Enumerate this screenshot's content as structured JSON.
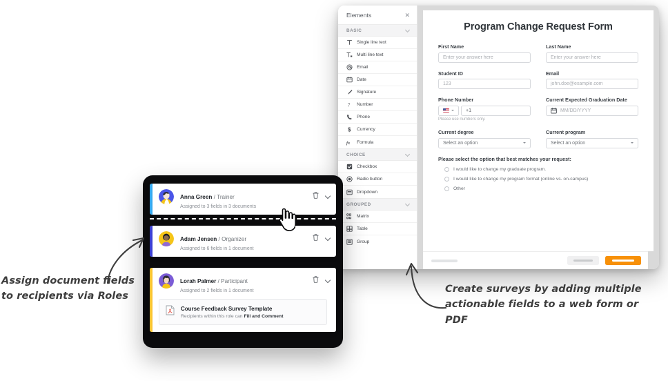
{
  "window": {
    "elements_panel": {
      "title": "Elements",
      "close_icon": "close-icon",
      "groups": [
        {
          "label": "BASIC",
          "items": [
            {
              "label": "Single line text",
              "icon": "single-line-text-icon"
            },
            {
              "label": "Multi line text",
              "icon": "multi-line-text-icon"
            },
            {
              "label": "Email",
              "icon": "email-icon"
            },
            {
              "label": "Date",
              "icon": "date-icon"
            },
            {
              "label": "Signature",
              "icon": "signature-icon"
            },
            {
              "label": "Number",
              "icon": "number-icon"
            },
            {
              "label": "Phone",
              "icon": "phone-icon"
            },
            {
              "label": "Currency",
              "icon": "currency-icon"
            },
            {
              "label": "Formula",
              "icon": "formula-icon"
            }
          ]
        },
        {
          "label": "CHOICE",
          "items": [
            {
              "label": "Checkbox",
              "icon": "checkbox-icon"
            },
            {
              "label": "Radio button",
              "icon": "radio-button-icon"
            },
            {
              "label": "Dropdown",
              "icon": "dropdown-icon"
            }
          ]
        },
        {
          "label": "GROUPED",
          "items": [
            {
              "label": "Matrix",
              "icon": "matrix-icon"
            },
            {
              "label": "Table",
              "icon": "table-icon"
            },
            {
              "label": "Group",
              "icon": "group-icon"
            }
          ]
        }
      ]
    },
    "form": {
      "title": "Program Change Request Form",
      "fields": [
        {
          "label": "First Name",
          "placeholder": "Enter your answer here",
          "type": "text"
        },
        {
          "label": "Last Name",
          "placeholder": "Enter your answer here",
          "type": "text"
        },
        {
          "label": "Student ID",
          "placeholder": "123",
          "type": "text"
        },
        {
          "label": "Email",
          "placeholder": "john.doe@example.com",
          "type": "text"
        },
        {
          "label": "Phone Number",
          "value": "+1",
          "country_code": "US",
          "help": "Please use numbers only.",
          "type": "phone"
        },
        {
          "label": "Current Expected Graduation Date",
          "placeholder": "MM/DD/YYYY",
          "type": "date"
        },
        {
          "label": "Current degree",
          "value": "Select an option",
          "type": "select"
        },
        {
          "label": "Current program",
          "value": "Select an option",
          "type": "select"
        }
      ],
      "question": {
        "text": "Please select the option that best matches your request:",
        "options": [
          "I would like to change my graduate program.",
          "I would like to change my program format (online vs. on-campus)",
          "Other"
        ]
      },
      "footer": {
        "primary_color": "#f79009"
      }
    }
  },
  "roles": {
    "cards": [
      {
        "name": "Anna Green",
        "separator": "/",
        "role": "Trainer",
        "assigned": "Assigned to 3 fields in 3 documents",
        "accent": "#35a9f0",
        "delete_icon": "trash-icon",
        "expand_icon": "chevron-down-icon"
      },
      {
        "name": "Adam Jensen",
        "separator": "/",
        "role": "Organizer",
        "assigned": "Assigned to 6 fields in 1 document",
        "accent": "#3a3fd4",
        "delete_icon": "trash-icon",
        "expand_icon": "chevron-down-icon"
      },
      {
        "name": "Lorah Palmer",
        "separator": "/",
        "role": "Participant",
        "assigned": "Assigned to 2 fields in 1 document",
        "accent": "#fbc531",
        "delete_icon": "trash-icon",
        "expand_icon": "chevron-down-icon",
        "document": {
          "title": "Course Feedback Survey Template",
          "permission_prefix": "Recipients within this role can",
          "permission": "Fill and Comment",
          "icon": "pdf-file-icon"
        }
      }
    ]
  },
  "annotations": {
    "left": "Assign document fields to recipients via Roles",
    "right": "Create surveys by adding multiple actionable fields to a web form or PDF"
  }
}
